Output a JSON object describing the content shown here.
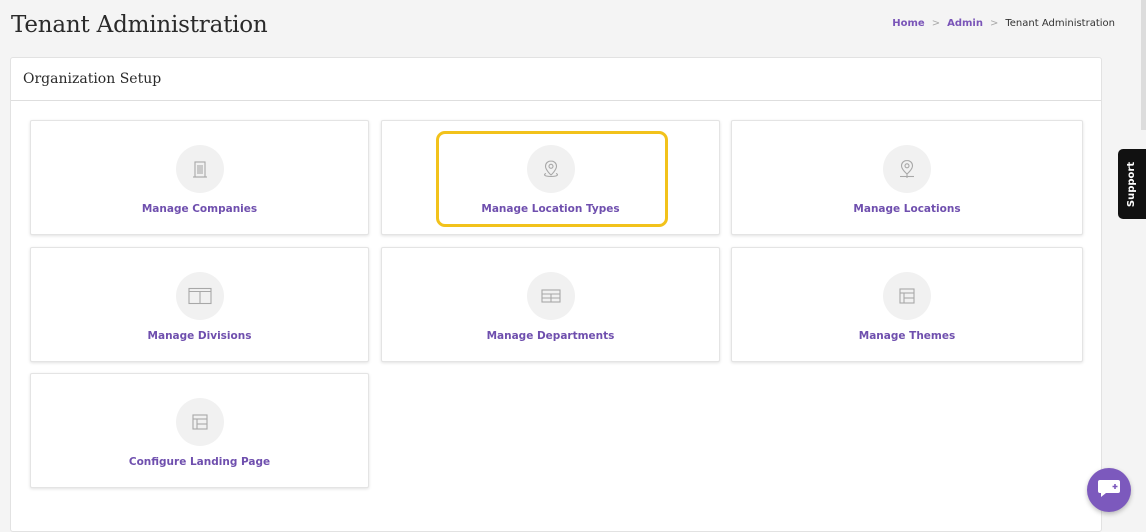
{
  "header": {
    "title": "Tenant Administration",
    "breadcrumb": {
      "home": "Home",
      "admin": "Admin",
      "current": "Tenant Administration",
      "separator": ">"
    }
  },
  "panel": {
    "title": "Organization Setup",
    "tiles": [
      {
        "label": "Manage Companies",
        "icon": "building-icon"
      },
      {
        "label": "Manage Location Types",
        "icon": "map-pin-icon"
      },
      {
        "label": "Manage Locations",
        "icon": "location-marker-icon"
      },
      {
        "label": "Manage Divisions",
        "icon": "columns-icon"
      },
      {
        "label": "Manage Departments",
        "icon": "grid-table-icon"
      },
      {
        "label": "Manage Themes",
        "icon": "layout-icon"
      },
      {
        "label": "Configure Landing Page",
        "icon": "layout-icon"
      }
    ]
  },
  "support": {
    "label": "Support"
  },
  "chat": {
    "icon": "chat-bubble-icon"
  },
  "colors": {
    "accent": "#6f4fae",
    "highlight": "#f2c21b",
    "chat_button": "#7c59bd"
  }
}
